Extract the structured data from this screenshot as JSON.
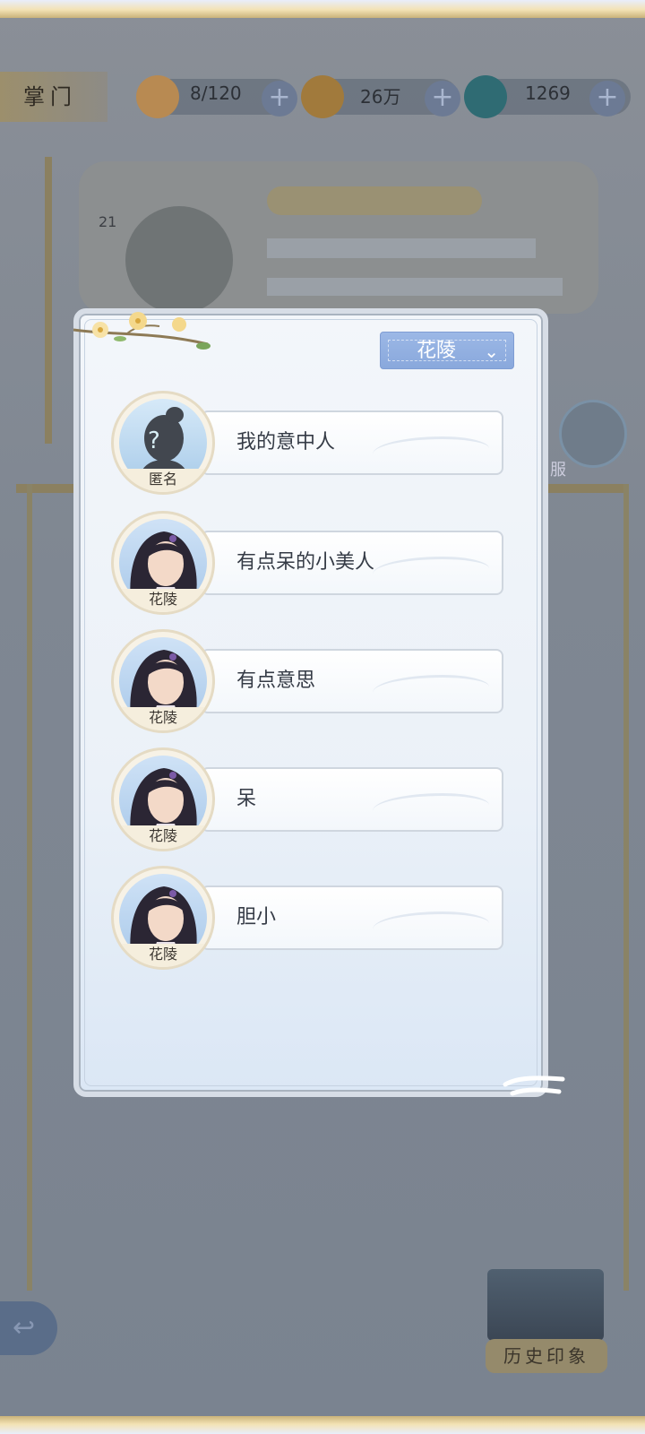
{
  "header": {
    "master_label": "掌门",
    "resources": [
      {
        "icon": "cat-stamina-icon",
        "value": "8/120"
      },
      {
        "icon": "coin-icon",
        "value": "26万"
      },
      {
        "icon": "jade-icon",
        "value": "1269"
      }
    ],
    "plus_label": "+"
  },
  "background": {
    "level": "21",
    "side_button_label": "服"
  },
  "modal": {
    "filter": {
      "selected": "花陵",
      "chevron": "⌄"
    },
    "entries": [
      {
        "name": "匿名",
        "text": "我的意中人",
        "anonymous": true,
        "avatar_mark": "?"
      },
      {
        "name": "花陵",
        "text": "有点呆的小美人",
        "anonymous": false
      },
      {
        "name": "花陵",
        "text": "有点意思",
        "anonymous": false
      },
      {
        "name": "花陵",
        "text": "呆",
        "anonymous": false
      },
      {
        "name": "花陵",
        "text": "胆小",
        "anonymous": false
      }
    ]
  },
  "footer": {
    "back_icon": "↩",
    "history_label": "历史印象"
  },
  "colors": {
    "filter_bg": "#94b2e1",
    "modal_bg": "#eef3f9",
    "overlay": "#7d8590"
  }
}
